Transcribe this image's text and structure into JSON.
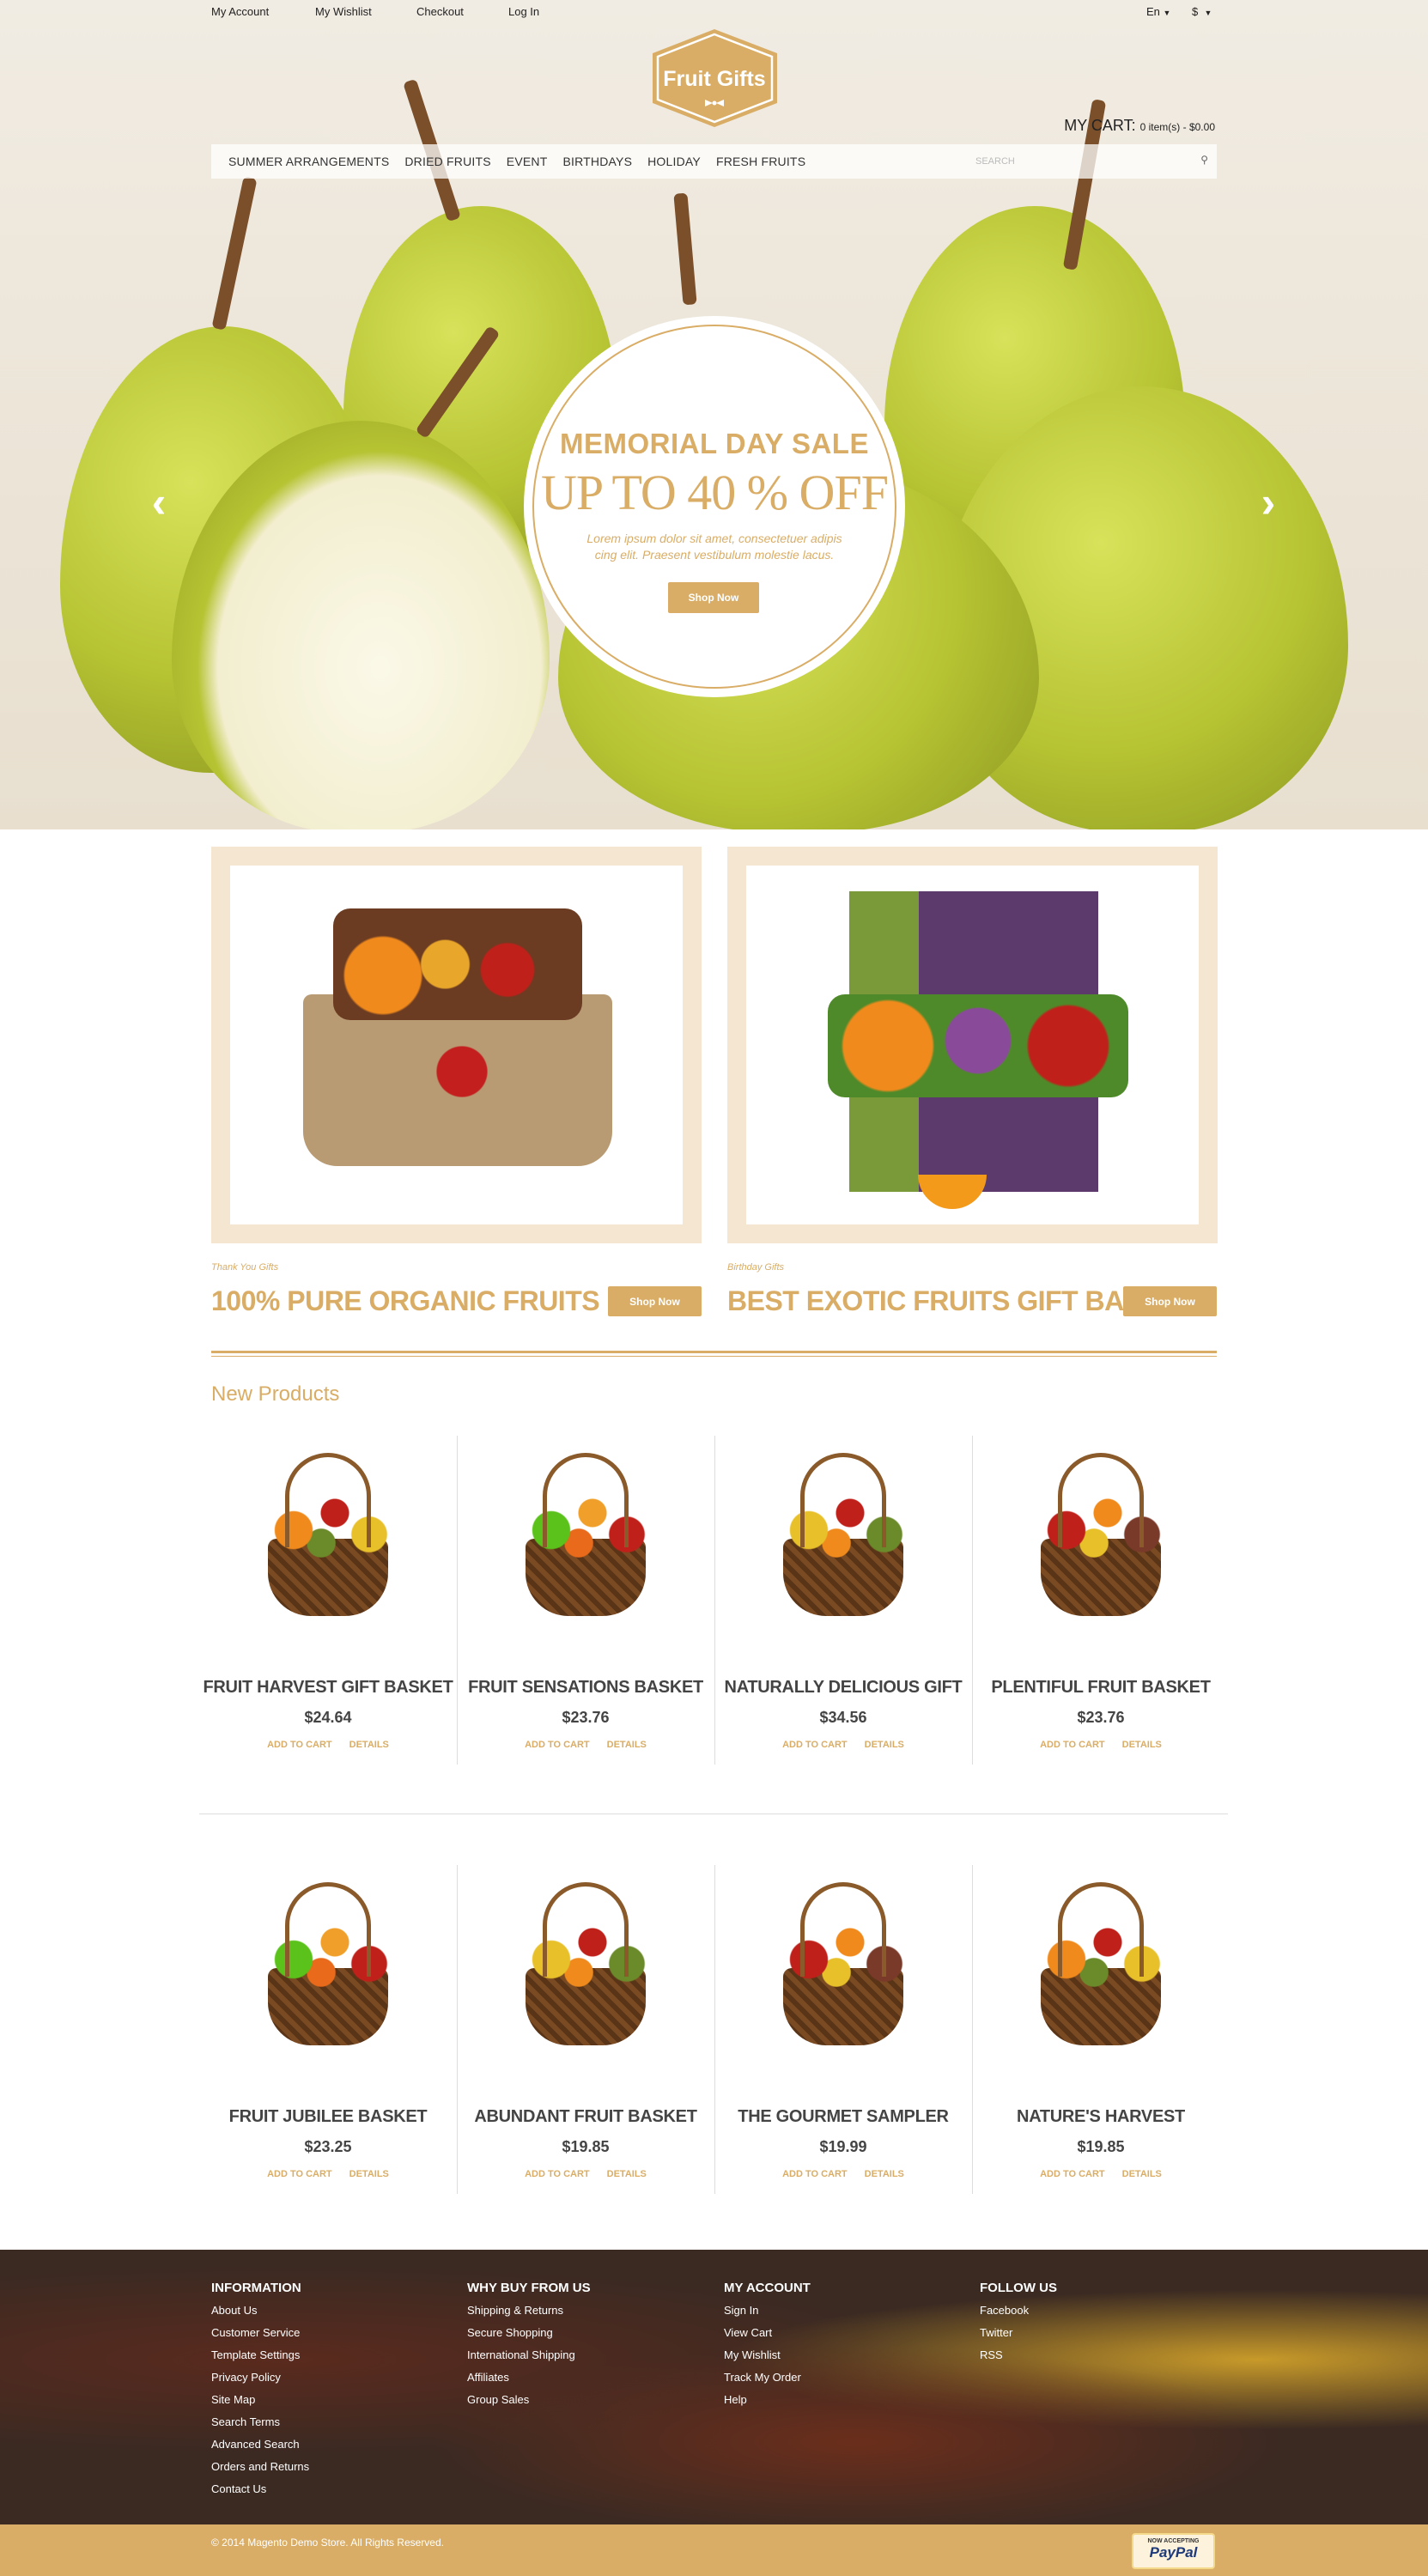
{
  "colors": {
    "accent": "#d9ad66",
    "banner_frame": "#f5e6d2",
    "text_dark": "#444444"
  },
  "top_links": [
    "My Account",
    "My Wishlist",
    "Checkout",
    "Log In"
  ],
  "language": "En",
  "currency": "$",
  "logo": {
    "text": "Fruit Gifts"
  },
  "cart": {
    "label": "MY CART:",
    "summary": "0 item(s) - $0.00"
  },
  "nav": [
    "Summer Arrangements",
    "Dried Fruits",
    "Event",
    "Birthdays",
    "Holiday",
    "Fresh Fruits"
  ],
  "search": {
    "placeholder": "SEARCH",
    "icon": "search-icon"
  },
  "hero": {
    "title": "MEMORIAL DAY SALE",
    "headline": "UP TO 40 % OFF",
    "text": "Lorem ipsum dolor sit amet, consectetuer adipis cing elit. Praesent vestibulum molestie lacus.",
    "button": "Shop Now",
    "prev_icon": "chevron-left-icon",
    "next_icon": "chevron-right-icon"
  },
  "banners": [
    {
      "subtitle": "Thank You Gifts",
      "title": "100% PURE ORGANIC FRUITS",
      "button": "Shop Now"
    },
    {
      "subtitle": "Birthday Gifts",
      "title": "BEST EXOTIC FRUITS GIFT BASKET",
      "button": "Shop Now"
    }
  ],
  "new_products": {
    "heading": "New Products",
    "add_to_cart": "ADD TO CART",
    "details": "DETAILS",
    "items": [
      {
        "name": "FRUIT HARVEST GIFT BASKET",
        "price": "$24.64"
      },
      {
        "name": "FRUIT SENSATIONS BASKET",
        "price": "$23.76"
      },
      {
        "name": "NATURALLY DELICIOUS GIFT",
        "price": "$34.56"
      },
      {
        "name": "PLENTIFUL FRUIT BASKET",
        "price": "$23.76"
      },
      {
        "name": "FRUIT JUBILEE BASKET",
        "price": "$23.25"
      },
      {
        "name": "ABUNDANT FRUIT BASKET",
        "price": "$19.85"
      },
      {
        "name": "THE GOURMET SAMPLER",
        "price": "$19.99"
      },
      {
        "name": "NATURE'S HARVEST",
        "price": "$19.85"
      }
    ]
  },
  "footer": {
    "columns": [
      {
        "heading": "Information",
        "links": [
          "About Us",
          "Customer Service",
          "Template Settings",
          "Privacy Policy",
          "Site Map",
          "Search Terms",
          "Advanced Search",
          "Orders and Returns",
          "Contact Us"
        ]
      },
      {
        "heading": "Why Buy From Us",
        "links": [
          "Shipping & Returns",
          "Secure Shopping",
          "International Shipping",
          "Affiliates",
          "Group Sales"
        ]
      },
      {
        "heading": "My Account",
        "links": [
          "Sign In",
          "View Cart",
          "My Wishlist",
          "Track My Order",
          "Help"
        ]
      },
      {
        "heading": "Follow Us",
        "links": [
          "Facebook",
          "Twitter",
          "RSS"
        ]
      }
    ],
    "copyright": "© 2014 Magento Demo Store. All Rights Reserved.",
    "paypal": {
      "line1": "NOW ACCEPTING",
      "line2": "PayPal"
    }
  }
}
